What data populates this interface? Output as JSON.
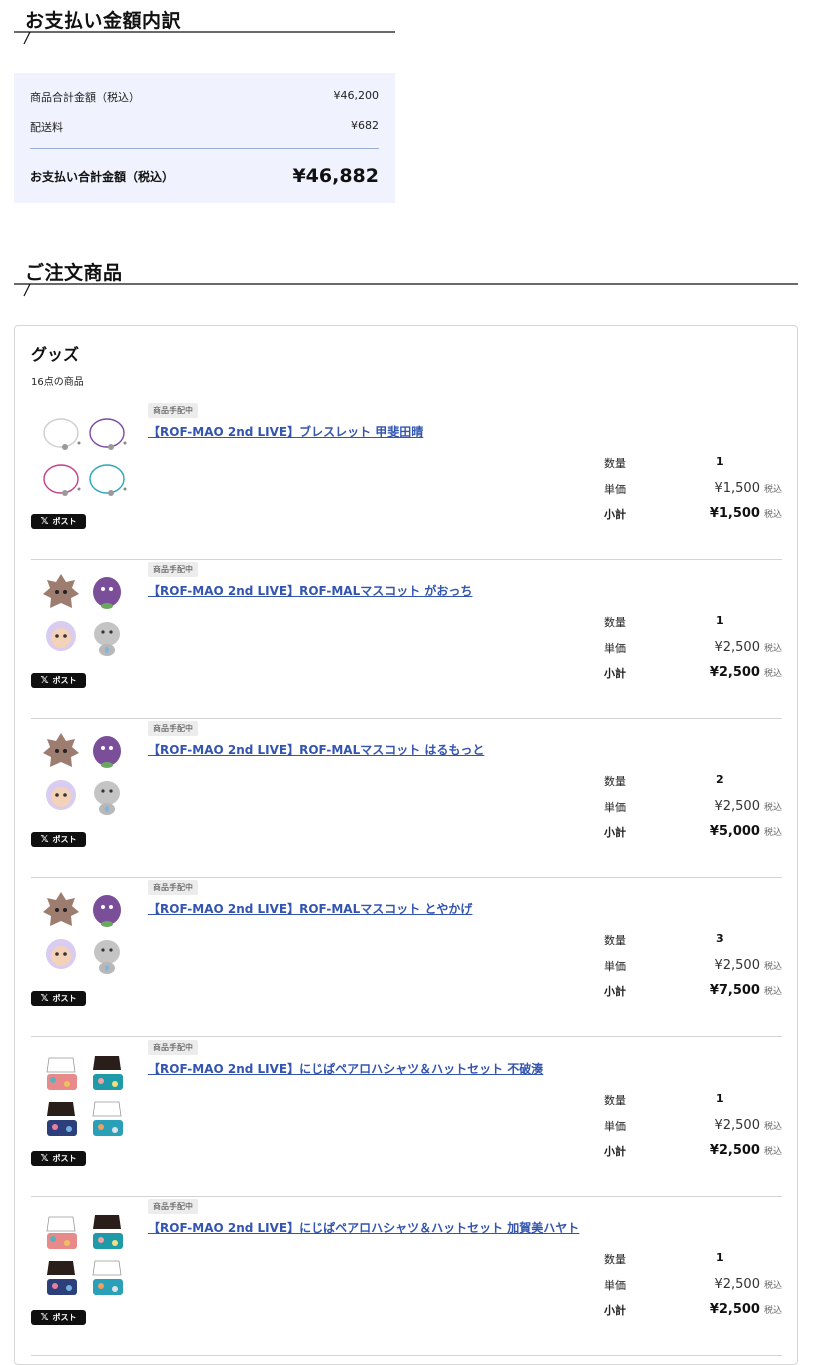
{
  "payment": {
    "heading": "お支払い金額内訳",
    "subtotal_label": "商品合計金額（税込）",
    "subtotal_value": "¥46,200",
    "shipping_label": "配送料",
    "shipping_value": "¥682",
    "total_label": "お支払い合計金額（税込）",
    "total_value": "¥46,882"
  },
  "order": {
    "heading": "ご注文商品",
    "category_title": "グッズ",
    "item_count": "16点の商品",
    "labels": {
      "qty": "数量",
      "unit_price": "単価",
      "subtotal": "小計",
      "tax": "税込",
      "post_button": "ポスト",
      "x_glyph": "𝕏"
    },
    "items": [
      {
        "status": "商品手配中",
        "title": "【ROF-MAO 2nd LIVE】ブレスレット 甲斐田晴",
        "qty": "1",
        "unit_price": "¥1,500",
        "subtotal": "¥1,500",
        "thumb": "bracelets"
      },
      {
        "status": "商品手配中",
        "title": "【ROF-MAO 2nd LIVE】ROF-MALマスコット がおっち",
        "qty": "1",
        "unit_price": "¥2,500",
        "subtotal": "¥2,500",
        "thumb": "mascots"
      },
      {
        "status": "商品手配中",
        "title": "【ROF-MAO 2nd LIVE】ROF-MALマスコット はるもっと",
        "qty": "2",
        "unit_price": "¥2,500",
        "subtotal": "¥5,000",
        "thumb": "mascots"
      },
      {
        "status": "商品手配中",
        "title": "【ROF-MAO 2nd LIVE】ROF-MALマスコット とやかげ",
        "qty": "3",
        "unit_price": "¥2,500",
        "subtotal": "¥7,500",
        "thumb": "mascots"
      },
      {
        "status": "商品手配中",
        "title": "【ROF-MAO 2nd LIVE】にじぱペアロハシャツ＆ハットセット 不破湊",
        "qty": "1",
        "unit_price": "¥2,500",
        "subtotal": "¥2,500",
        "thumb": "shirts"
      },
      {
        "status": "商品手配中",
        "title": "【ROF-MAO 2nd LIVE】にじぱペアロハシャツ＆ハットセット 加賀美ハヤト",
        "qty": "1",
        "unit_price": "¥2,500",
        "subtotal": "¥2,500",
        "thumb": "shirts"
      }
    ]
  },
  "colors": {
    "link": "#3355b0",
    "summary_bg": "#f0f3fd",
    "post_button_bg": "#0f0f0f"
  }
}
